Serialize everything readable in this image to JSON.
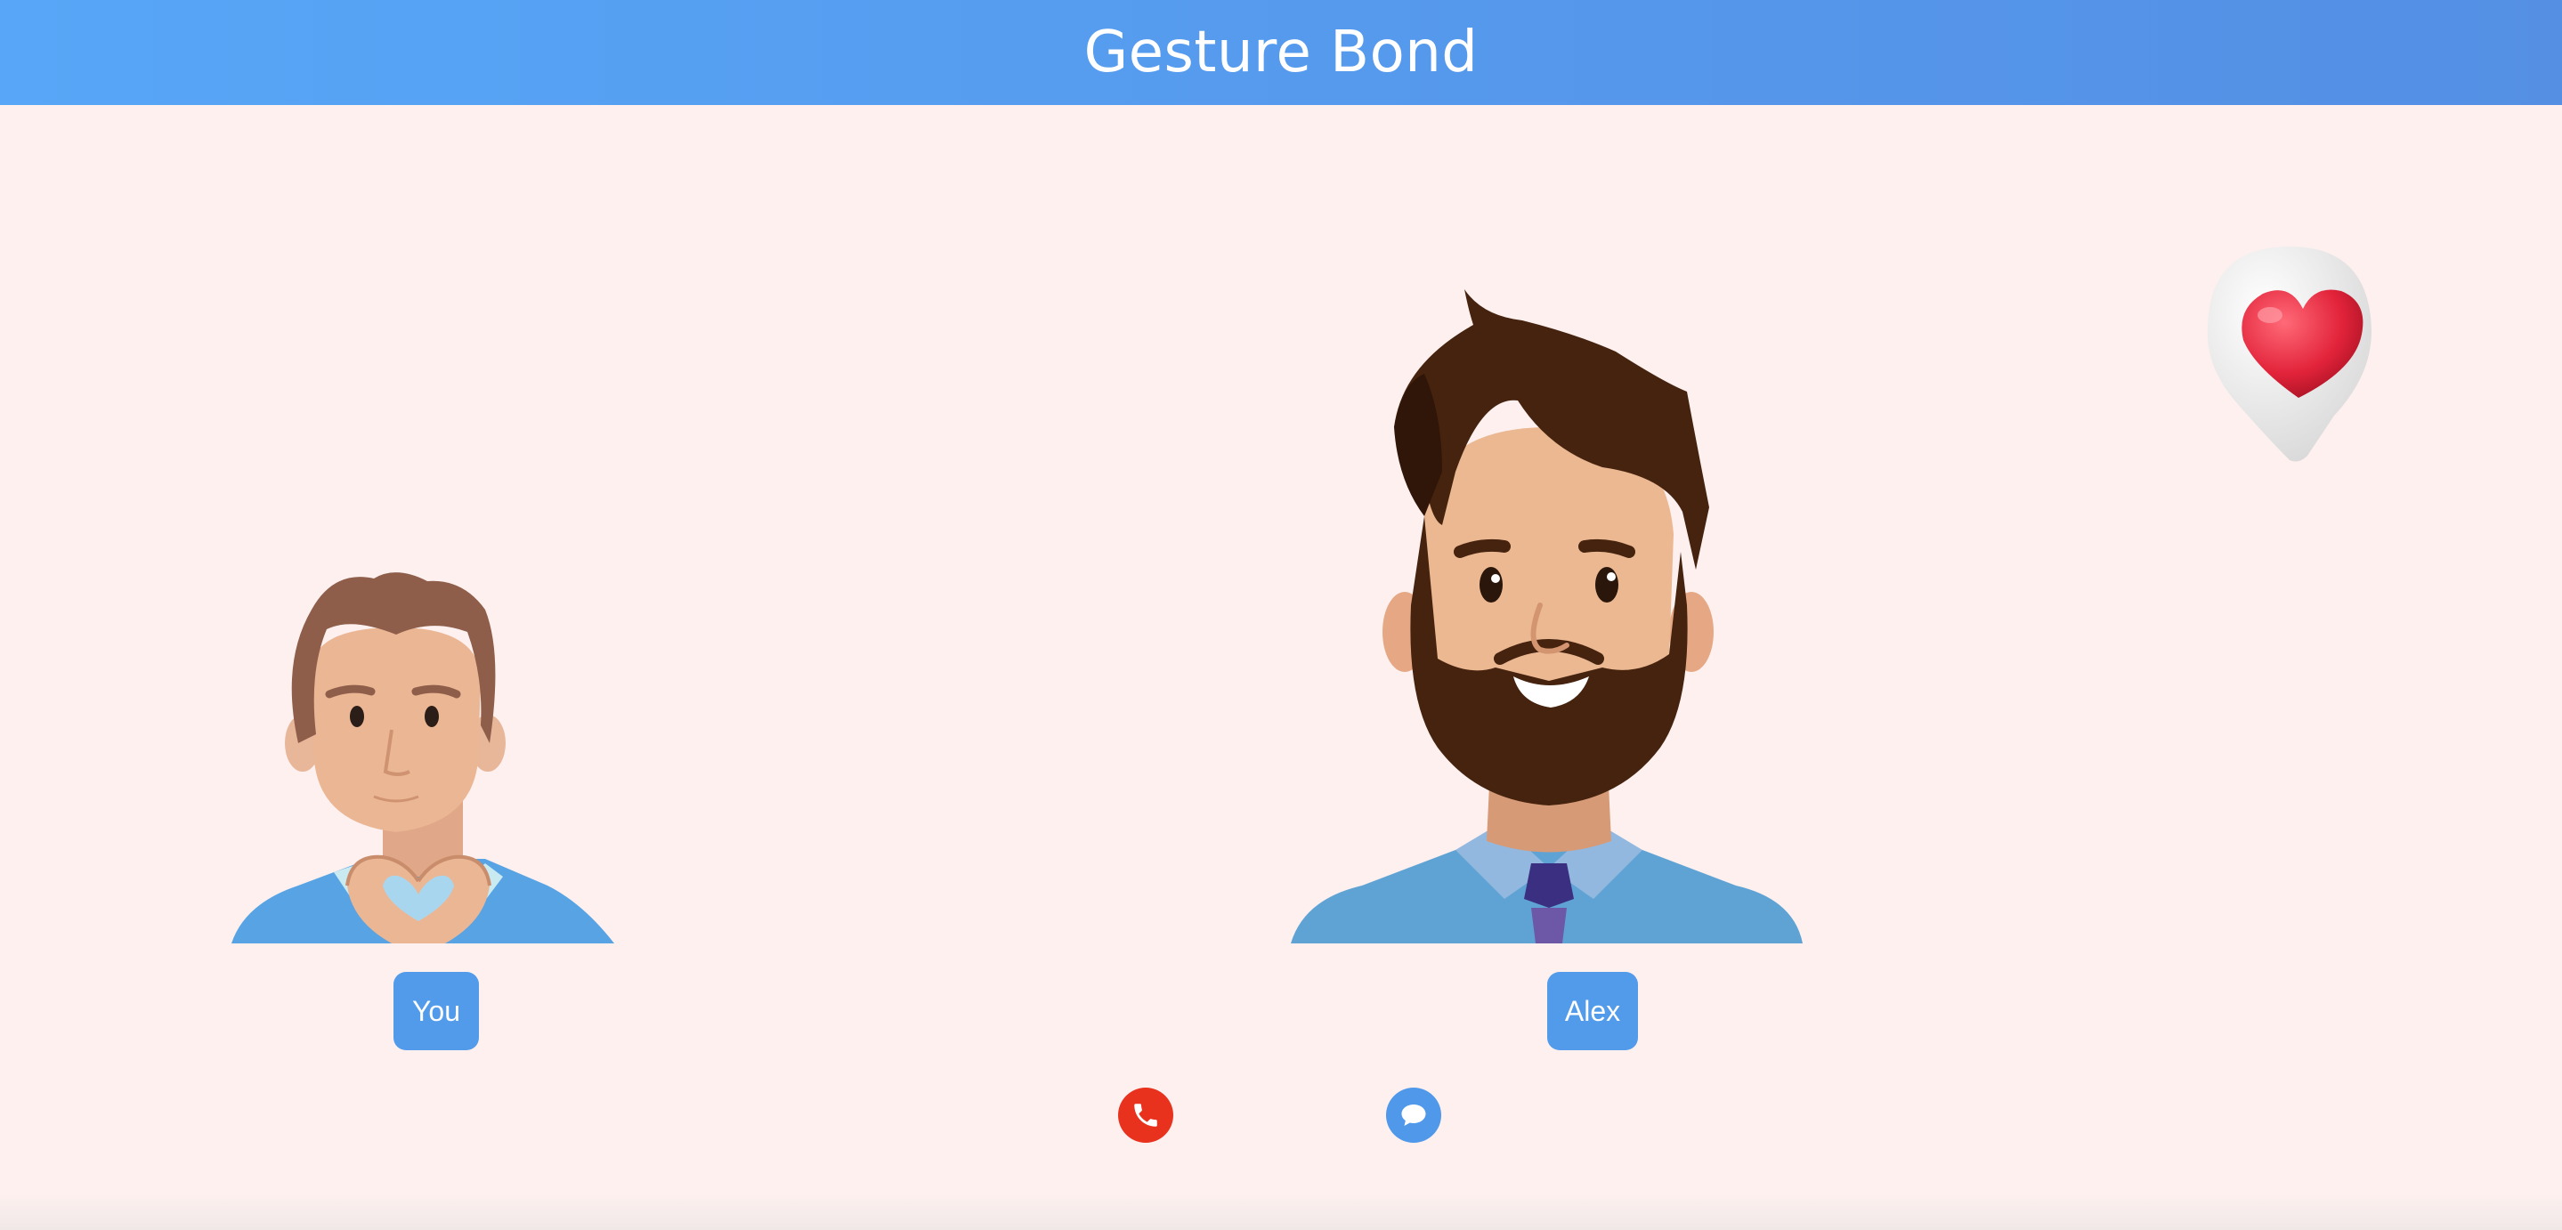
{
  "app": {
    "title": "Gesture Bond"
  },
  "participants": [
    {
      "label": "You",
      "gesture": "heart-hands"
    },
    {
      "label": "Alex"
    }
  ],
  "reaction": {
    "icon": "heart-icon"
  },
  "controls": [
    {
      "icon": "phone-icon",
      "action": "call",
      "color": "#e8321e"
    },
    {
      "icon": "chat-icon",
      "action": "chat",
      "color": "#4f98ea"
    }
  ],
  "colors": {
    "header_start": "#57a6f7",
    "header_end": "#548fe4",
    "background": "#fdf0ef",
    "badge": "#519bea"
  }
}
